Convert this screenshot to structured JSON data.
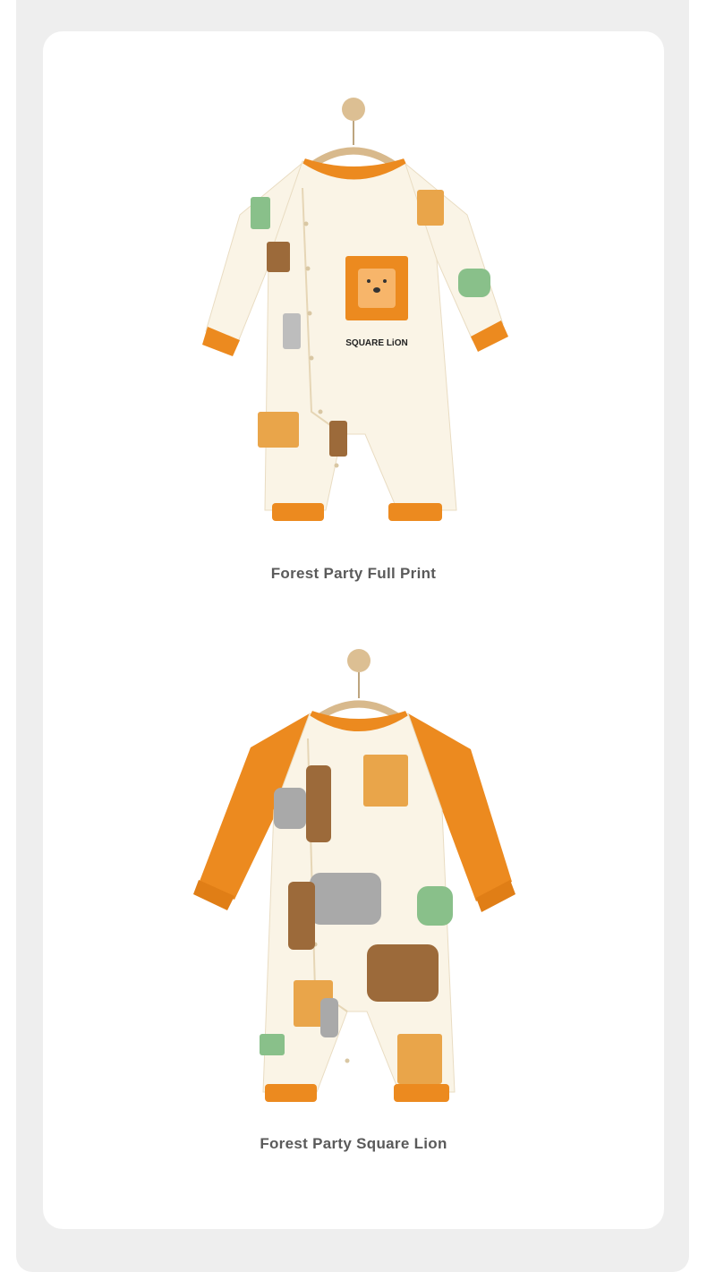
{
  "colors": {
    "panel_bg": "#eeeeee",
    "card_bg": "#ffffff",
    "accent_orange": "#ec8a1f",
    "fabric_cream": "#faf4e6",
    "caption_text": "#5a5a5a"
  },
  "products": [
    {
      "caption": "Forest Party Full Print",
      "chest_print_text": "SQUARE LiON",
      "image_icon": "romper-full-print-icon"
    },
    {
      "caption": "Forest Party Square Lion",
      "image_icon": "romper-square-lion-icon"
    }
  ]
}
